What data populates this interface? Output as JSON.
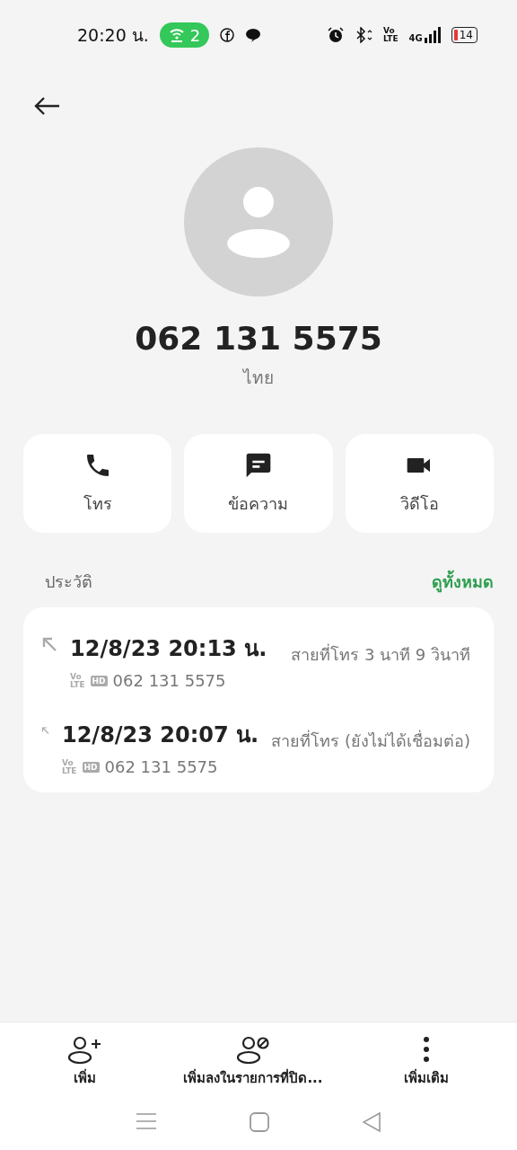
{
  "status_bar": {
    "time": "20:20 น.",
    "hotspot_count": "2",
    "volte": {
      "top": "Vo",
      "bottom": "LTE"
    },
    "network": "4G",
    "battery": "14"
  },
  "contact": {
    "number": "062 131 5575",
    "location": "ไทย"
  },
  "actions": [
    {
      "kind": "call",
      "label": "โทร"
    },
    {
      "kind": "message",
      "label": "ข้อความ"
    },
    {
      "kind": "video",
      "label": "วิดีโอ"
    }
  ],
  "history": {
    "title": "ประวัติ",
    "view_all": "ดูทั้งหมด",
    "entries": [
      {
        "datetime": "12/8/23 20:13 น.",
        "volte": {
          "top": "Vo",
          "bottom": "LTE"
        },
        "hd": "HD",
        "number": "062 131 5575",
        "detail": "สายที่โทร  3 นาที 9 วินาที"
      },
      {
        "datetime": "12/8/23 20:07 น.",
        "volte": {
          "top": "Vo",
          "bottom": "LTE"
        },
        "hd": "HD",
        "number": "062 131 5575",
        "detail": "สายที่โทร (ยังไม่ได้เชื่อมต่อ)"
      }
    ]
  },
  "bottom_bar": [
    {
      "kind": "add",
      "label": "เพิ่ม"
    },
    {
      "kind": "block",
      "label": "เพิ่มลงในรายการที่ปิด..."
    },
    {
      "kind": "more",
      "label": "เพิ่มเติม"
    }
  ]
}
